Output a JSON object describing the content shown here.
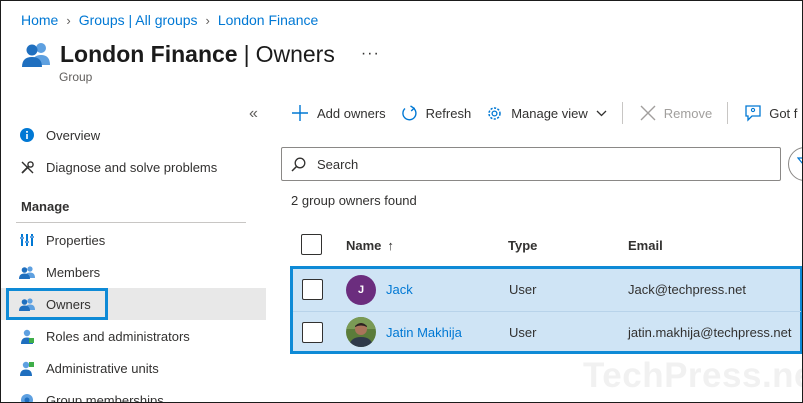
{
  "breadcrumb": [
    "Home",
    "Groups | All groups",
    "London Finance"
  ],
  "header": {
    "title_strong": "London Finance",
    "title_sep": "|",
    "title_rest": "Owners",
    "more": "···",
    "subtitle": "Group"
  },
  "sidebar": {
    "collapse": "«",
    "items_top": [
      {
        "label": "Overview",
        "icon": "info-icon"
      },
      {
        "label": "Diagnose and solve problems",
        "icon": "wrench-icon"
      }
    ],
    "section": "Manage",
    "items": [
      {
        "label": "Properties",
        "icon": "properties-icon"
      },
      {
        "label": "Members",
        "icon": "members-icon"
      },
      {
        "label": "Owners",
        "icon": "owners-icon",
        "active": true
      },
      {
        "label": "Roles and administrators",
        "icon": "roles-icon"
      },
      {
        "label": "Administrative units",
        "icon": "admin-units-icon"
      },
      {
        "label": "Group memberships",
        "icon": "group-memberships-icon"
      }
    ]
  },
  "toolbar": {
    "add": "Add owners",
    "refresh": "Refresh",
    "manage_view": "Manage view",
    "remove": "Remove",
    "feedback": "Got f"
  },
  "search": {
    "placeholder": "Search"
  },
  "count_text": "2 group owners found",
  "table": {
    "columns": {
      "name": "Name",
      "sort": "↑",
      "type": "Type",
      "email": "Email"
    },
    "rows": [
      {
        "initial": "J",
        "name": "Jack",
        "type": "User",
        "email": "Jack@techpress.net"
      },
      {
        "initial": "",
        "name": "Jatin Makhija",
        "type": "User",
        "email": "jatin.makhija@techpress.net"
      }
    ]
  },
  "watermark": "TechPress.net",
  "colors": {
    "accent": "#0078d4",
    "highlight": "#0e8ad6",
    "selected_row": "#cfe4f5",
    "avatar": "#6b2d7e"
  }
}
